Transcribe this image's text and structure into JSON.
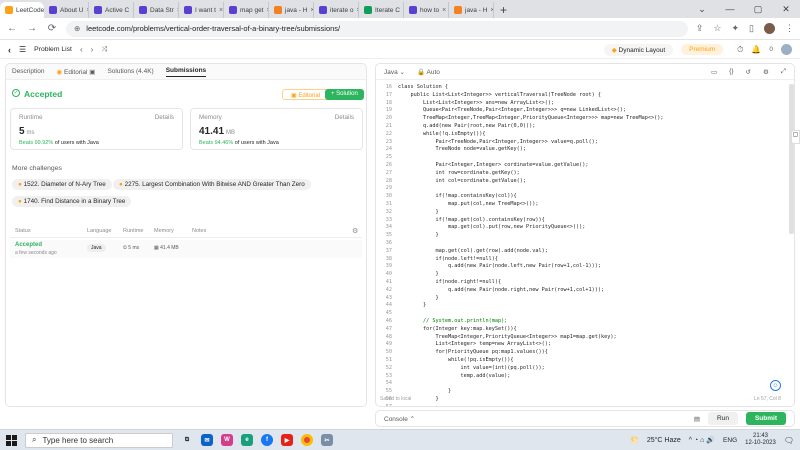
{
  "browser": {
    "tabs": [
      {
        "label": "LeetCode",
        "icon": "leetcode-icon",
        "color": "#ffa116",
        "active": true
      },
      {
        "label": "About U",
        "icon": "w-icon",
        "color": "#5b3fd1"
      },
      {
        "label": "Active C",
        "icon": "w-icon",
        "color": "#5b3fd1"
      },
      {
        "label": "Data Str",
        "icon": "w-icon",
        "color": "#5b3fd1"
      },
      {
        "label": "I want t",
        "icon": "w-icon",
        "color": "#5b3fd1"
      },
      {
        "label": "map get",
        "icon": "w-icon",
        "color": "#5b3fd1"
      },
      {
        "label": "java - H",
        "icon": "java-icon",
        "color": "#f48024"
      },
      {
        "label": "iterate o",
        "icon": "w-icon",
        "color": "#5b3fd1"
      },
      {
        "label": "Iterate C",
        "icon": "doc-icon",
        "color": "#0f9d58"
      },
      {
        "label": "how to",
        "icon": "w-icon",
        "color": "#5b3fd1"
      },
      {
        "label": "java - H",
        "icon": "java-icon",
        "color": "#f48024"
      }
    ],
    "url": "leetcode.com/problems/vertical-order-traversal-of-a-binary-tree/submissions/"
  },
  "lc_header": {
    "problem_list": "Problem List",
    "dynamic_layout": "Dynamic Layout",
    "premium": "Premium",
    "notif_count": "0"
  },
  "left": {
    "tabs": [
      "Description",
      "Editorial",
      "Solutions (4.4K)",
      "Submissions"
    ],
    "status": "Accepted",
    "editorial_btn": "Editorial",
    "solution_btn": "+ Solution",
    "runtime": {
      "label": "Runtime",
      "details": "Details",
      "value": "5",
      "unit": "ms",
      "beats": "Beats 99.92%",
      "beats_suffix": "of users with Java"
    },
    "memory": {
      "label": "Memory",
      "details": "Details",
      "value": "41.41",
      "unit": "MB",
      "beats": "Beats 94.46%",
      "beats_suffix": "of users with Java"
    },
    "more_challenges": "More challenges",
    "challenges": [
      "1522. Diameter of N-Ary Tree",
      "2275. Largest Combination With Bitwise AND Greater Than Zero",
      "1740. Find Distance in a Binary Tree"
    ],
    "table_headers": [
      "Status",
      "Language",
      "Runtime",
      "Memory",
      "Notes"
    ],
    "row": {
      "status": "Accepted",
      "time": "a few seconds ago",
      "lang": "Java",
      "runtime": "5 ms",
      "memory": "41.4 MB"
    }
  },
  "editor": {
    "language": "Java",
    "mode": "Auto",
    "saved": "Saved to local",
    "ln_col": "Ln 57, Col 8",
    "lines": [
      {
        "n": "16",
        "t": "class Solution {"
      },
      {
        "n": "17",
        "t": "    public List<List<Integer>> verticalTraversal(TreeNode root) {"
      },
      {
        "n": "18",
        "t": "        List<List<Integer>> ans=new ArrayList<>();"
      },
      {
        "n": "19",
        "t": "        Queue<Pair<TreeNode,Pair<Integer,Integer>>> q=new LinkedList<>();"
      },
      {
        "n": "20",
        "t": "        TreeMap<Integer,TreeMap<Integer,PriorityQueue<Integer>>> map=new TreeMap<>();"
      },
      {
        "n": "21",
        "t": "        q.add(new Pair(root,new Pair(0,0)));"
      },
      {
        "n": "22",
        "t": "        while(!q.isEmpty()){"
      },
      {
        "n": "23",
        "t": "            Pair<TreeNode,Pair<Integer,Integer>> value=q.poll();"
      },
      {
        "n": "24",
        "t": "            TreeNode node=value.getKey();"
      },
      {
        "n": "25",
        "t": ""
      },
      {
        "n": "26",
        "t": "            Pair<Integer,Integer> cordinate=value.getValue();"
      },
      {
        "n": "27",
        "t": "            int row=cordinate.getKey();"
      },
      {
        "n": "28",
        "t": "            int col=cordinate.getValue();"
      },
      {
        "n": "29",
        "t": ""
      },
      {
        "n": "30",
        "t": "            if(!map.containsKey(col)){"
      },
      {
        "n": "31",
        "t": "                map.put(col,new TreeMap<>());"
      },
      {
        "n": "32",
        "t": "            }"
      },
      {
        "n": "33",
        "t": "            if(!map.get(col).containsKey(row)){"
      },
      {
        "n": "34",
        "t": "                map.get(col).put(row,new PriorityQueue<>());"
      },
      {
        "n": "35",
        "t": "            }"
      },
      {
        "n": "36",
        "t": ""
      },
      {
        "n": "37",
        "t": "            map.get(col).get(row).add(node.val);"
      },
      {
        "n": "38",
        "t": "            if(node.left!=null){"
      },
      {
        "n": "39",
        "t": "                q.add(new Pair(node.left,new Pair(row+1,col-1)));"
      },
      {
        "n": "40",
        "t": "            }"
      },
      {
        "n": "41",
        "t": "            if(node.right!=null){"
      },
      {
        "n": "42",
        "t": "                q.add(new Pair(node.right,new Pair(row+1,col+1)));"
      },
      {
        "n": "43",
        "t": "            }"
      },
      {
        "n": "44",
        "t": "        }"
      },
      {
        "n": "45",
        "t": ""
      },
      {
        "n": "46",
        "t": "        // System.out.println(map);"
      },
      {
        "n": "47",
        "t": "        for(Integer key:map.keySet()){"
      },
      {
        "n": "48",
        "t": "            TreeMap<Integer,PriorityQueue<Integer>> map1=map.get(key);"
      },
      {
        "n": "49",
        "t": "            List<Integer> temp=new ArrayList<>();"
      },
      {
        "n": "50",
        "t": "            for(PriorityQueue pq:map1.values()){"
      },
      {
        "n": "51",
        "t": "                while(!pq.isEmpty()){"
      },
      {
        "n": "52",
        "t": "                    int value=(int)(pq.poll());"
      },
      {
        "n": "53",
        "t": "                    temp.add(value);"
      },
      {
        "n": "54",
        "t": ""
      },
      {
        "n": "55",
        "t": "                }"
      },
      {
        "n": "56",
        "t": "            }"
      },
      {
        "n": "57",
        "t": ""
      }
    ]
  },
  "console": {
    "label": "Console",
    "run": "Run",
    "submit": "Submit"
  },
  "taskbar": {
    "search_placeholder": "Type here to search",
    "weather": "25°C Haze",
    "lang": "ENG",
    "time": "21:43",
    "date": "12-10-2023"
  }
}
